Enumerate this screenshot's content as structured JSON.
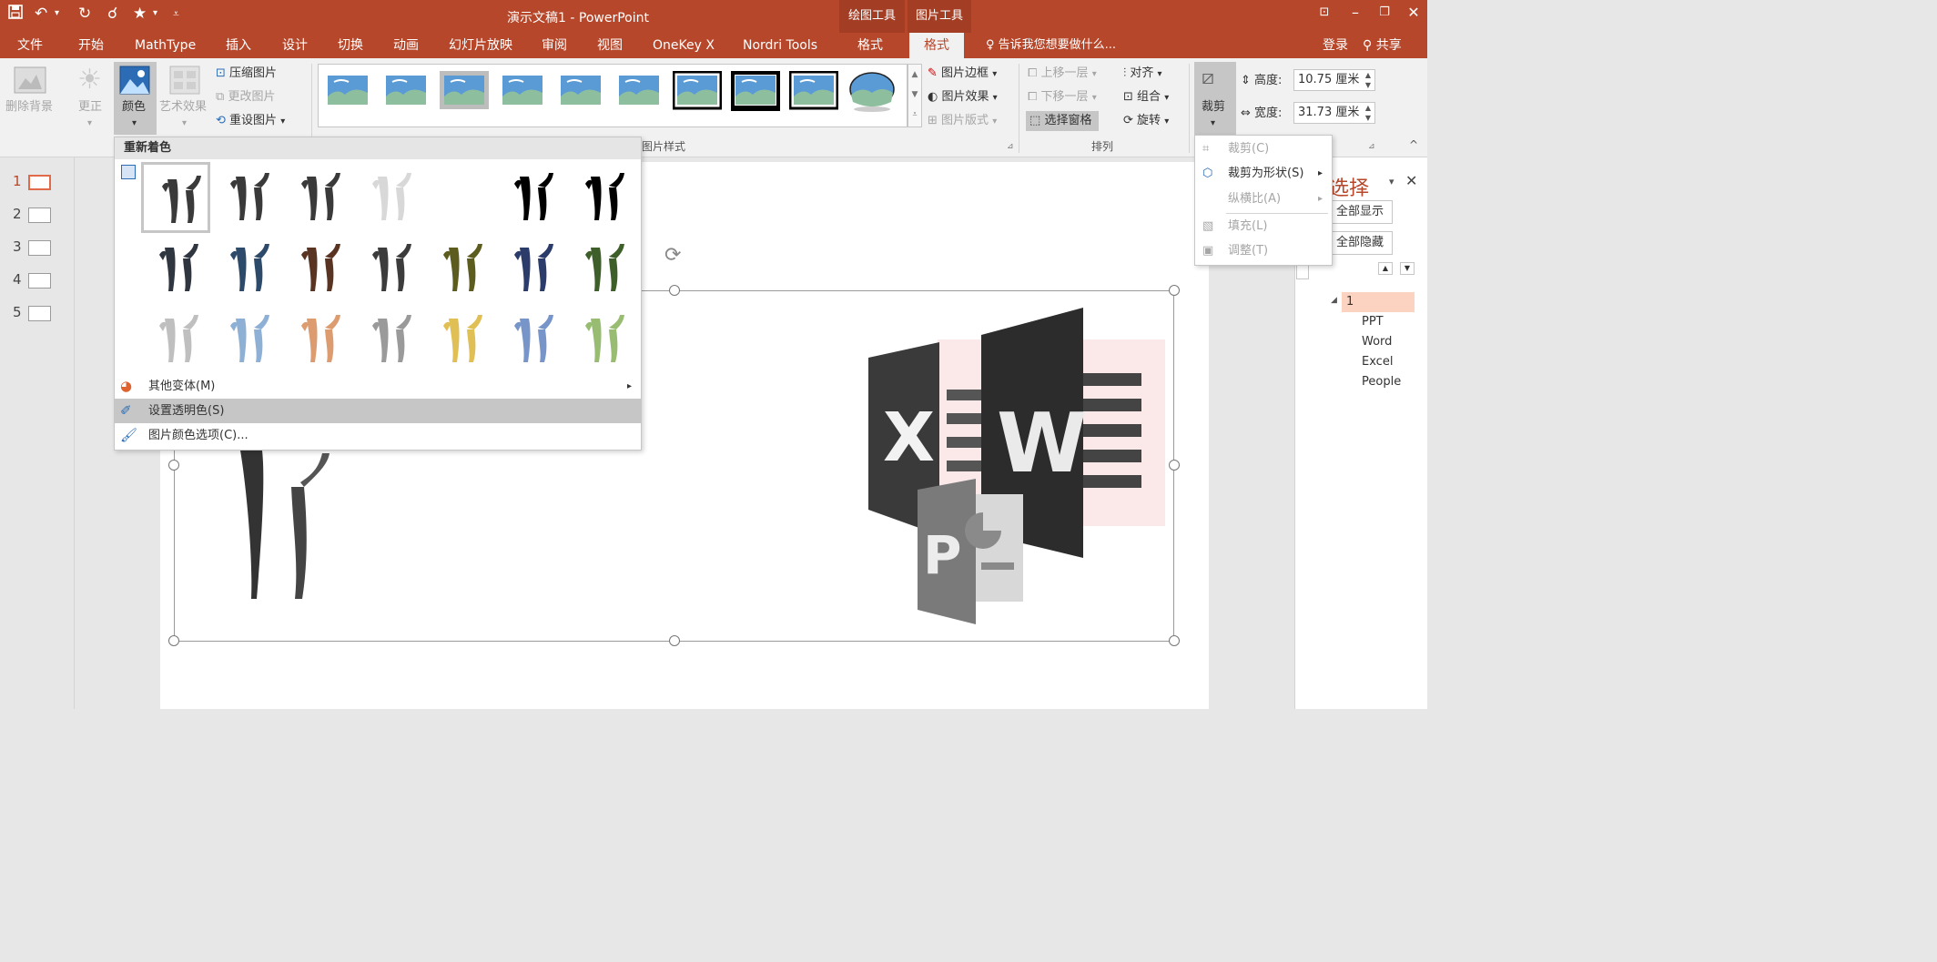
{
  "app": {
    "title": "演示文稿1 - PowerPoint"
  },
  "context_groups": {
    "drawing_tools": "绘图工具",
    "picture_tools": "图片工具"
  },
  "tabs": [
    "文件",
    "开始",
    "MathType",
    "插入",
    "设计",
    "切换",
    "动画",
    "幻灯片放映",
    "审阅",
    "视图",
    "OneKey X",
    "Nordri Tools",
    "格式",
    "格式"
  ],
  "tell_me": "告诉我您想要做什么...",
  "account": {
    "login": "登录",
    "share": "共享"
  },
  "ribbon": {
    "remove_bg": "删除背景",
    "corrections": "更正",
    "color": "颜色",
    "artistic": "艺术效果",
    "compress": "压缩图片",
    "change": "更改图片",
    "reset": "重设图片",
    "border": "图片边框",
    "effects": "图片效果",
    "layout": "图片版式",
    "bring_forward": "上移一层",
    "send_backward": "下移一层",
    "selection_pane": "选择窗格",
    "align": "对齐",
    "group": "组合",
    "rotate": "旋转",
    "crop": "裁剪",
    "height_label": "高度:",
    "height_value": "10.75 厘米",
    "width_label": "宽度:",
    "width_value": "31.73 厘米",
    "group_styles": "图片样式",
    "group_arrange": "排列"
  },
  "slides": [
    "1",
    "2",
    "3",
    "4",
    "5"
  ],
  "recolor_menu": {
    "title": "重新着色",
    "more_variations": "其他变体(M)",
    "set_transparent": "设置透明色(S)",
    "color_options": "图片颜色选项(C)..."
  },
  "crop_menu": {
    "crop": "裁剪(C)",
    "crop_to_shape": "裁剪为形状(S)",
    "aspect_ratio": "纵横比(A)",
    "fill": "填充(L)",
    "fit": "调整(T)"
  },
  "selection_pane": {
    "title": "选择",
    "show_all": "全部显示",
    "hide_all": "全部隐藏",
    "group": "1",
    "items": [
      "PPT",
      "Word",
      "Excel",
      "People"
    ]
  },
  "recolor_colors": [
    [
      "#3a3a3a",
      "#3a3a3a",
      "#3a3a3a",
      "#d8d8d8",
      "#ffffff",
      "#000000",
      "#000000"
    ],
    [
      "#2f3640",
      "#2e4a6a",
      "#5a3422",
      "#3c3c3c",
      "#5c5c1e",
      "#2b3b6a",
      "#3f5f2a"
    ],
    [
      "#bfbfbf",
      "#8fb0d5",
      "#dd9b70",
      "#9a9a9a",
      "#e0bf55",
      "#7795c9",
      "#98bd72"
    ]
  ],
  "colors": {
    "accent": "#b7472a",
    "ribbon": "#f1f1f1",
    "highlight": "#c6c6c6"
  }
}
